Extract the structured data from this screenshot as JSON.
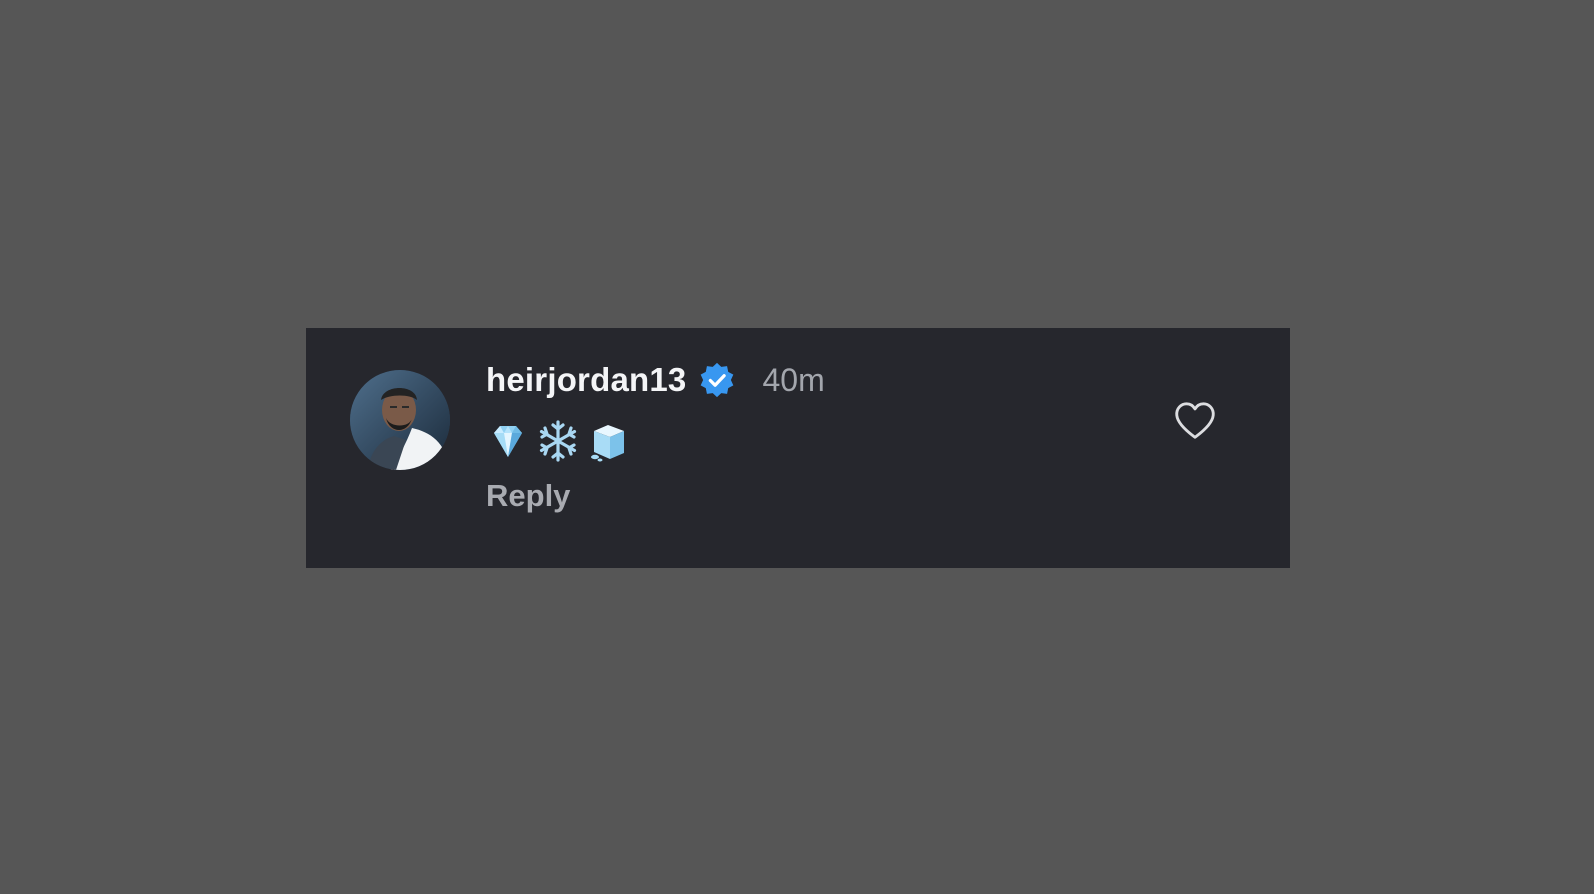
{
  "comment": {
    "username": "heirjordan13",
    "verified": true,
    "timestamp": "40m",
    "emojis": [
      {
        "icon": "gem-stone-emoji",
        "char": "💎"
      },
      {
        "icon": "snowflake-emoji",
        "char": "❄️"
      },
      {
        "icon": "ice-cube-emoji",
        "char": "🧊"
      }
    ],
    "reply_label": "Reply",
    "like_icon": "heart-outline-icon"
  },
  "colors": {
    "page_background": "#565656",
    "card_background": "#26272d",
    "username": "#f4f5f7",
    "timestamp": "#a3a6ad",
    "reply": "#a9abb1",
    "verified_badge": "#3897f0",
    "heart_outline": "#dcdde0"
  }
}
